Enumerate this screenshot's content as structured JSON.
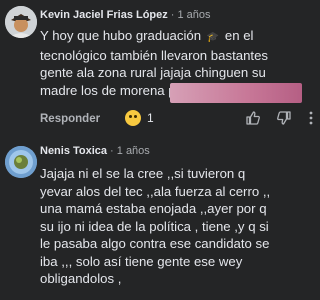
{
  "comments": [
    {
      "author": "Kevin Jaciel Frias López",
      "time": "· 1 años",
      "lines": [
        "Y hoy que hubo graduación",
        "en el",
        "tecnológico también llevaron bastantes",
        "gente ala zona rural jajaja chinguen su",
        "madre los de morena pu"
      ],
      "reply_label": "Responder",
      "reaction_count": "1"
    },
    {
      "author": "Nenis Toxica",
      "time": "· 1 años",
      "lines": [
        "Jajaja ni  el se la cree ,,si tuvieron q",
        "yevar alos del tec ,,ala fuerza  al cerro ,,",
        "una mamá estaba enojada ,,ayer por q",
        "su ijo ni idea de la política , tiene ,y q si",
        "le pasaba algo contra ese candidato se",
        "iba ,,, solo así tiene gente ese wey",
        "obligandolos ,"
      ]
    }
  ],
  "colors": {
    "background": "#242526",
    "redaction": "#c77797"
  },
  "icons": [
    "graduation-cap-icon",
    "laughing-emoji-icon",
    "thumbs-up-icon",
    "thumbs-down-icon",
    "more-options-icon"
  ]
}
